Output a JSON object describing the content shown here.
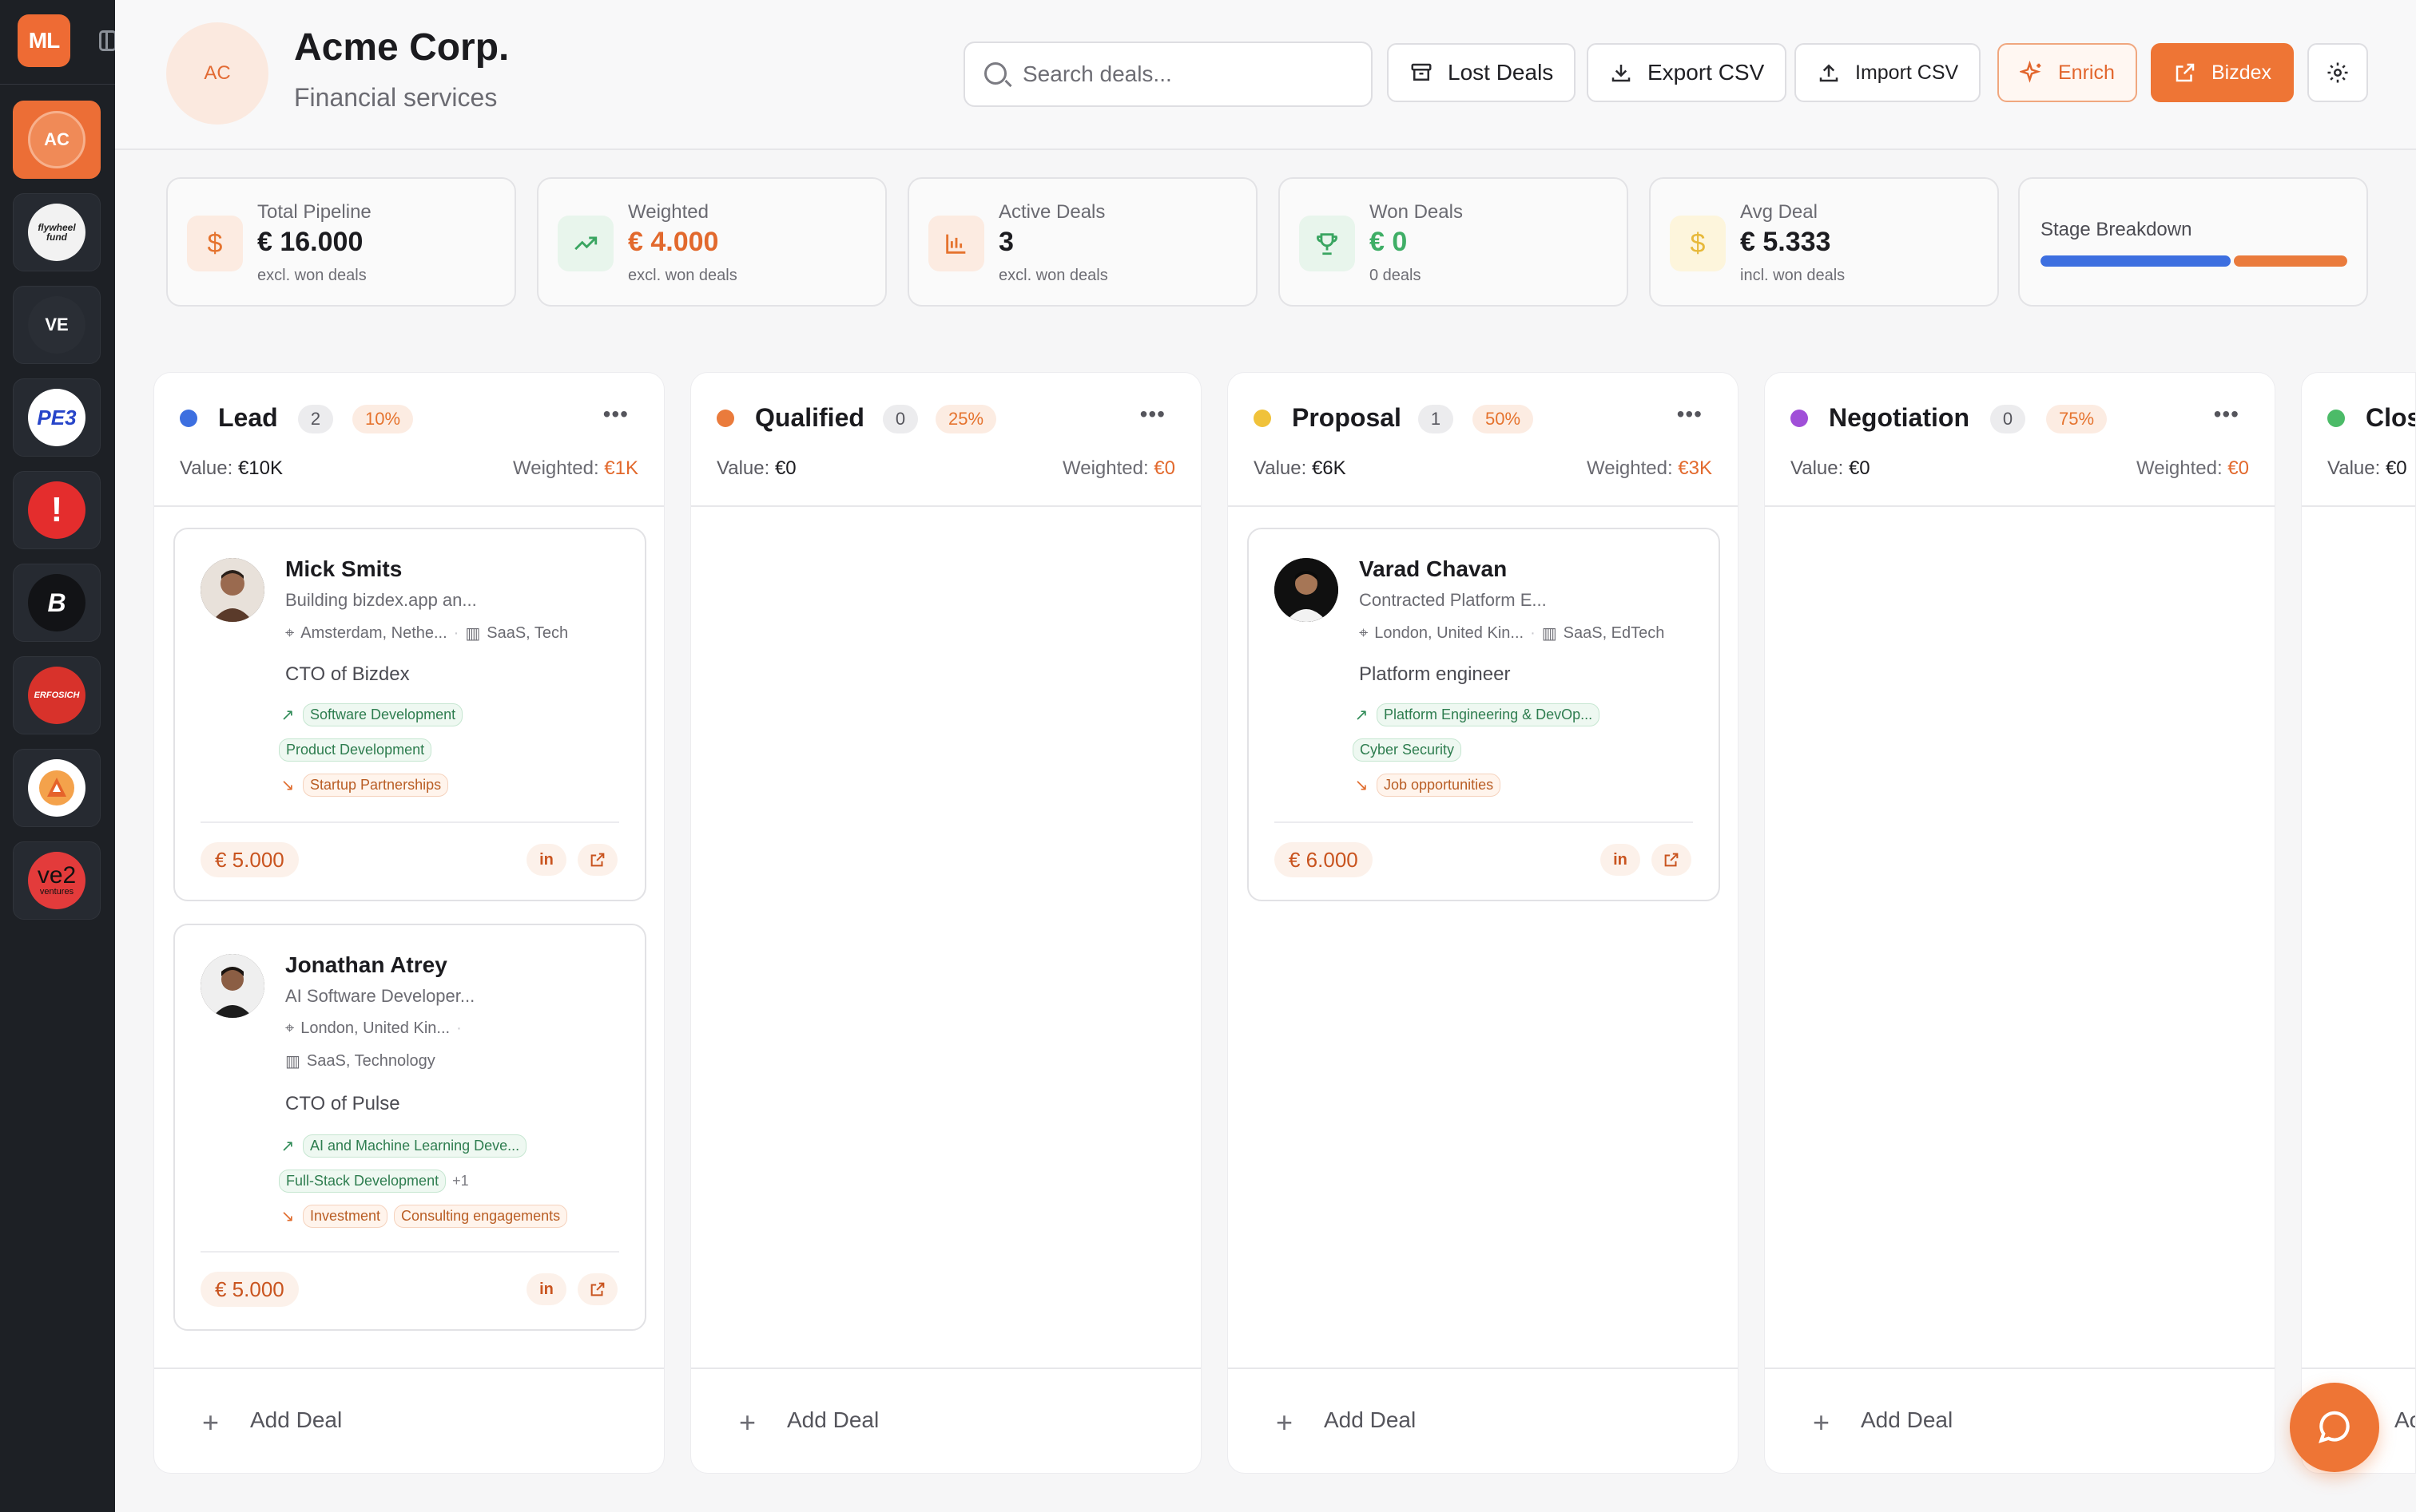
{
  "sidebar": {
    "user_initials": "ML",
    "workspaces": [
      {
        "label": "AC",
        "active": true
      },
      {
        "label": "flywheel fund",
        "active": false
      },
      {
        "label": "VE",
        "active": false
      },
      {
        "label": "PE3",
        "active": false
      },
      {
        "label": "!",
        "active": false
      },
      {
        "label": "B",
        "active": false
      },
      {
        "label": "ERFOSICH",
        "active": false
      },
      {
        "label": "",
        "active": false
      },
      {
        "label": "ve2",
        "sublabel": "ventures",
        "active": false
      }
    ]
  },
  "header": {
    "avatar_initials": "AC",
    "company_name": "Acme Corp.",
    "company_sector": "Financial services",
    "search_placeholder": "Search deals...",
    "lost_deals_label": "Lost Deals",
    "export_label": "Export CSV",
    "import_label": "Import CSV",
    "enrich_label": "Enrich",
    "bizdex_label": "Bizdex"
  },
  "stats": [
    {
      "label": "Total Pipeline",
      "value": "€ 16.000",
      "note": "excl. won deals",
      "value_color": "#1c1c20"
    },
    {
      "label": "Weighted",
      "value": "€ 4.000",
      "note": "excl. won deals",
      "value_color": "#e2692d"
    },
    {
      "label": "Active Deals",
      "value": "3",
      "note": "excl. won deals",
      "value_color": "#1c1c20"
    },
    {
      "label": "Won Deals",
      "value": "€ 0",
      "note": "0 deals",
      "value_color": "#3fae66"
    },
    {
      "label": "Avg Deal",
      "value": "€ 5.333",
      "note": "incl. won deals",
      "value_color": "#1c1c20"
    }
  ],
  "stage_breakdown": {
    "label": "Stage Breakdown",
    "segments": [
      {
        "stage": "Lead",
        "share": 0.625,
        "color": "#3d6fe0"
      },
      {
        "stage": "Proposal",
        "share": 0.375,
        "color": "#ea7b3c"
      }
    ]
  },
  "columns": [
    {
      "title": "Lead",
      "count": "2",
      "probability": "10%",
      "value_label": "Value:",
      "value": "€10K",
      "weighted_label": "Weighted:",
      "weighted": "€1K",
      "dot_color": "#3d6fe0",
      "add_label": "Add Deal"
    },
    {
      "title": "Qualified",
      "count": "0",
      "probability": "25%",
      "value_label": "Value:",
      "value": "€0",
      "weighted_label": "Weighted:",
      "weighted": "€0",
      "dot_color": "#ea7b3c",
      "add_label": "Add Deal"
    },
    {
      "title": "Proposal",
      "count": "1",
      "probability": "50%",
      "value_label": "Value:",
      "value": "€6K",
      "weighted_label": "Weighted:",
      "weighted": "€3K",
      "dot_color": "#f0c23a",
      "add_label": "Add Deal"
    },
    {
      "title": "Negotiation",
      "count": "0",
      "probability": "75%",
      "value_label": "Value:",
      "value": "€0",
      "weighted_label": "Weighted:",
      "weighted": "€0",
      "dot_color": "#a04fd8",
      "add_label": "Add Deal"
    },
    {
      "title": "Clos",
      "value_label": "Value:",
      "value": "€0",
      "dot_color": "#4cbb68",
      "add_label": "Ac"
    }
  ],
  "deals": {
    "mick": {
      "name": "Mick Smits",
      "headline": "Building bizdex.app an...",
      "location": "Amsterdam, Nethe...",
      "industry": "SaaS, Tech",
      "role": "CTO of Bizdex",
      "offers": [
        "Software Development",
        "Product Development"
      ],
      "wants": [
        "Startup Partnerships"
      ],
      "amount": "€ 5.000"
    },
    "jonathan": {
      "name": "Jonathan Atrey",
      "headline": "AI Software Developer...",
      "location": "London, United Kin...",
      "industry": "SaaS, Technology",
      "role": "CTO of Pulse",
      "offers": [
        "AI and Machine Learning Deve...",
        "Full-Stack Development"
      ],
      "offers_more": "+1",
      "wants": [
        "Investment",
        "Consulting engagements"
      ],
      "amount": "€ 5.000"
    },
    "varad": {
      "name": "Varad Chavan",
      "headline": "Contracted Platform E...",
      "location": "London, United Kin...",
      "industry": "SaaS, EdTech",
      "role": "Platform engineer",
      "offers": [
        "Platform Engineering & DevOp...",
        "Cyber Security"
      ],
      "wants": [
        "Job opportunities"
      ],
      "amount": "€ 6.000"
    }
  }
}
